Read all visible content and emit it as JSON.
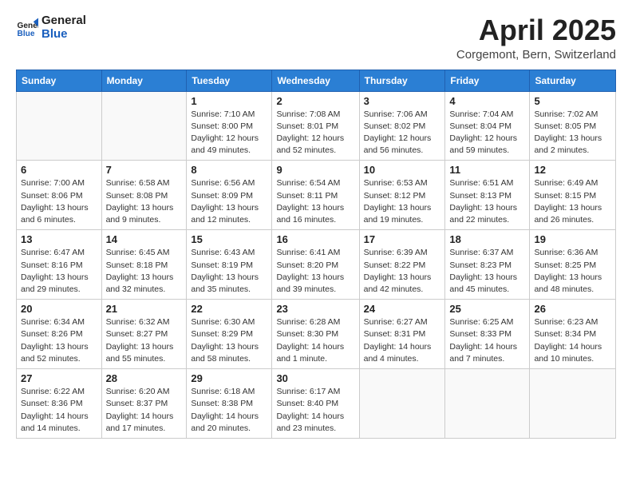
{
  "logo": {
    "line1": "General",
    "line2": "Blue"
  },
  "title": "April 2025",
  "subtitle": "Corgemont, Bern, Switzerland",
  "weekdays": [
    "Sunday",
    "Monday",
    "Tuesday",
    "Wednesday",
    "Thursday",
    "Friday",
    "Saturday"
  ],
  "weeks": [
    [
      {
        "day": "",
        "info": ""
      },
      {
        "day": "",
        "info": ""
      },
      {
        "day": "1",
        "info": "Sunrise: 7:10 AM\nSunset: 8:00 PM\nDaylight: 12 hours and 49 minutes."
      },
      {
        "day": "2",
        "info": "Sunrise: 7:08 AM\nSunset: 8:01 PM\nDaylight: 12 hours and 52 minutes."
      },
      {
        "day": "3",
        "info": "Sunrise: 7:06 AM\nSunset: 8:02 PM\nDaylight: 12 hours and 56 minutes."
      },
      {
        "day": "4",
        "info": "Sunrise: 7:04 AM\nSunset: 8:04 PM\nDaylight: 12 hours and 59 minutes."
      },
      {
        "day": "5",
        "info": "Sunrise: 7:02 AM\nSunset: 8:05 PM\nDaylight: 13 hours and 2 minutes."
      }
    ],
    [
      {
        "day": "6",
        "info": "Sunrise: 7:00 AM\nSunset: 8:06 PM\nDaylight: 13 hours and 6 minutes."
      },
      {
        "day": "7",
        "info": "Sunrise: 6:58 AM\nSunset: 8:08 PM\nDaylight: 13 hours and 9 minutes."
      },
      {
        "day": "8",
        "info": "Sunrise: 6:56 AM\nSunset: 8:09 PM\nDaylight: 13 hours and 12 minutes."
      },
      {
        "day": "9",
        "info": "Sunrise: 6:54 AM\nSunset: 8:11 PM\nDaylight: 13 hours and 16 minutes."
      },
      {
        "day": "10",
        "info": "Sunrise: 6:53 AM\nSunset: 8:12 PM\nDaylight: 13 hours and 19 minutes."
      },
      {
        "day": "11",
        "info": "Sunrise: 6:51 AM\nSunset: 8:13 PM\nDaylight: 13 hours and 22 minutes."
      },
      {
        "day": "12",
        "info": "Sunrise: 6:49 AM\nSunset: 8:15 PM\nDaylight: 13 hours and 26 minutes."
      }
    ],
    [
      {
        "day": "13",
        "info": "Sunrise: 6:47 AM\nSunset: 8:16 PM\nDaylight: 13 hours and 29 minutes."
      },
      {
        "day": "14",
        "info": "Sunrise: 6:45 AM\nSunset: 8:18 PM\nDaylight: 13 hours and 32 minutes."
      },
      {
        "day": "15",
        "info": "Sunrise: 6:43 AM\nSunset: 8:19 PM\nDaylight: 13 hours and 35 minutes."
      },
      {
        "day": "16",
        "info": "Sunrise: 6:41 AM\nSunset: 8:20 PM\nDaylight: 13 hours and 39 minutes."
      },
      {
        "day": "17",
        "info": "Sunrise: 6:39 AM\nSunset: 8:22 PM\nDaylight: 13 hours and 42 minutes."
      },
      {
        "day": "18",
        "info": "Sunrise: 6:37 AM\nSunset: 8:23 PM\nDaylight: 13 hours and 45 minutes."
      },
      {
        "day": "19",
        "info": "Sunrise: 6:36 AM\nSunset: 8:25 PM\nDaylight: 13 hours and 48 minutes."
      }
    ],
    [
      {
        "day": "20",
        "info": "Sunrise: 6:34 AM\nSunset: 8:26 PM\nDaylight: 13 hours and 52 minutes."
      },
      {
        "day": "21",
        "info": "Sunrise: 6:32 AM\nSunset: 8:27 PM\nDaylight: 13 hours and 55 minutes."
      },
      {
        "day": "22",
        "info": "Sunrise: 6:30 AM\nSunset: 8:29 PM\nDaylight: 13 hours and 58 minutes."
      },
      {
        "day": "23",
        "info": "Sunrise: 6:28 AM\nSunset: 8:30 PM\nDaylight: 14 hours and 1 minute."
      },
      {
        "day": "24",
        "info": "Sunrise: 6:27 AM\nSunset: 8:31 PM\nDaylight: 14 hours and 4 minutes."
      },
      {
        "day": "25",
        "info": "Sunrise: 6:25 AM\nSunset: 8:33 PM\nDaylight: 14 hours and 7 minutes."
      },
      {
        "day": "26",
        "info": "Sunrise: 6:23 AM\nSunset: 8:34 PM\nDaylight: 14 hours and 10 minutes."
      }
    ],
    [
      {
        "day": "27",
        "info": "Sunrise: 6:22 AM\nSunset: 8:36 PM\nDaylight: 14 hours and 14 minutes."
      },
      {
        "day": "28",
        "info": "Sunrise: 6:20 AM\nSunset: 8:37 PM\nDaylight: 14 hours and 17 minutes."
      },
      {
        "day": "29",
        "info": "Sunrise: 6:18 AM\nSunset: 8:38 PM\nDaylight: 14 hours and 20 minutes."
      },
      {
        "day": "30",
        "info": "Sunrise: 6:17 AM\nSunset: 8:40 PM\nDaylight: 14 hours and 23 minutes."
      },
      {
        "day": "",
        "info": ""
      },
      {
        "day": "",
        "info": ""
      },
      {
        "day": "",
        "info": ""
      }
    ]
  ]
}
